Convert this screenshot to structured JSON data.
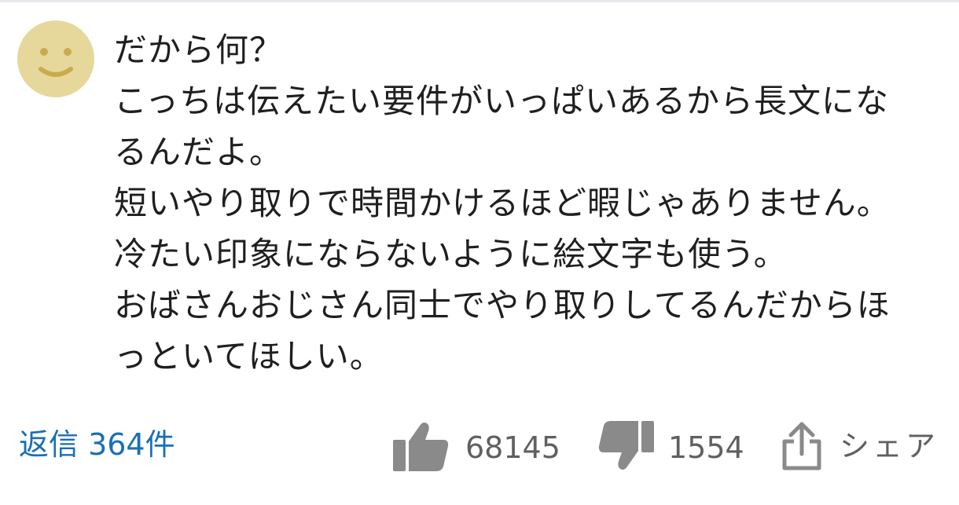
{
  "colors": {
    "avatar_bg": "#e6d89a",
    "avatar_face": "#c9ab4e",
    "reply_link": "#1a6fb5",
    "icon_gray": "#8a8a8a",
    "text_gray": "#606060"
  },
  "comment": {
    "avatar_icon": "smiley-face-icon",
    "lines": [
      "だから何？",
      "こっちは伝えたい要件がいっぱいあるから長文にな",
      "るんだよ。",
      "短いやり取りで時間かけるほど暇じゃありません。",
      "冷たい印象にならないように絵文字も使う。",
      "おばさんおじさん同士でやり取りしてるんだからほ",
      "っといてほしい。"
    ]
  },
  "actions": {
    "replies_label": "返信 364件",
    "like_icon": "thumbs-up-icon",
    "like_count": "68145",
    "dislike_icon": "thumbs-down-icon",
    "dislike_count": "1554",
    "share_icon": "share-icon",
    "share_label": "シェア"
  }
}
